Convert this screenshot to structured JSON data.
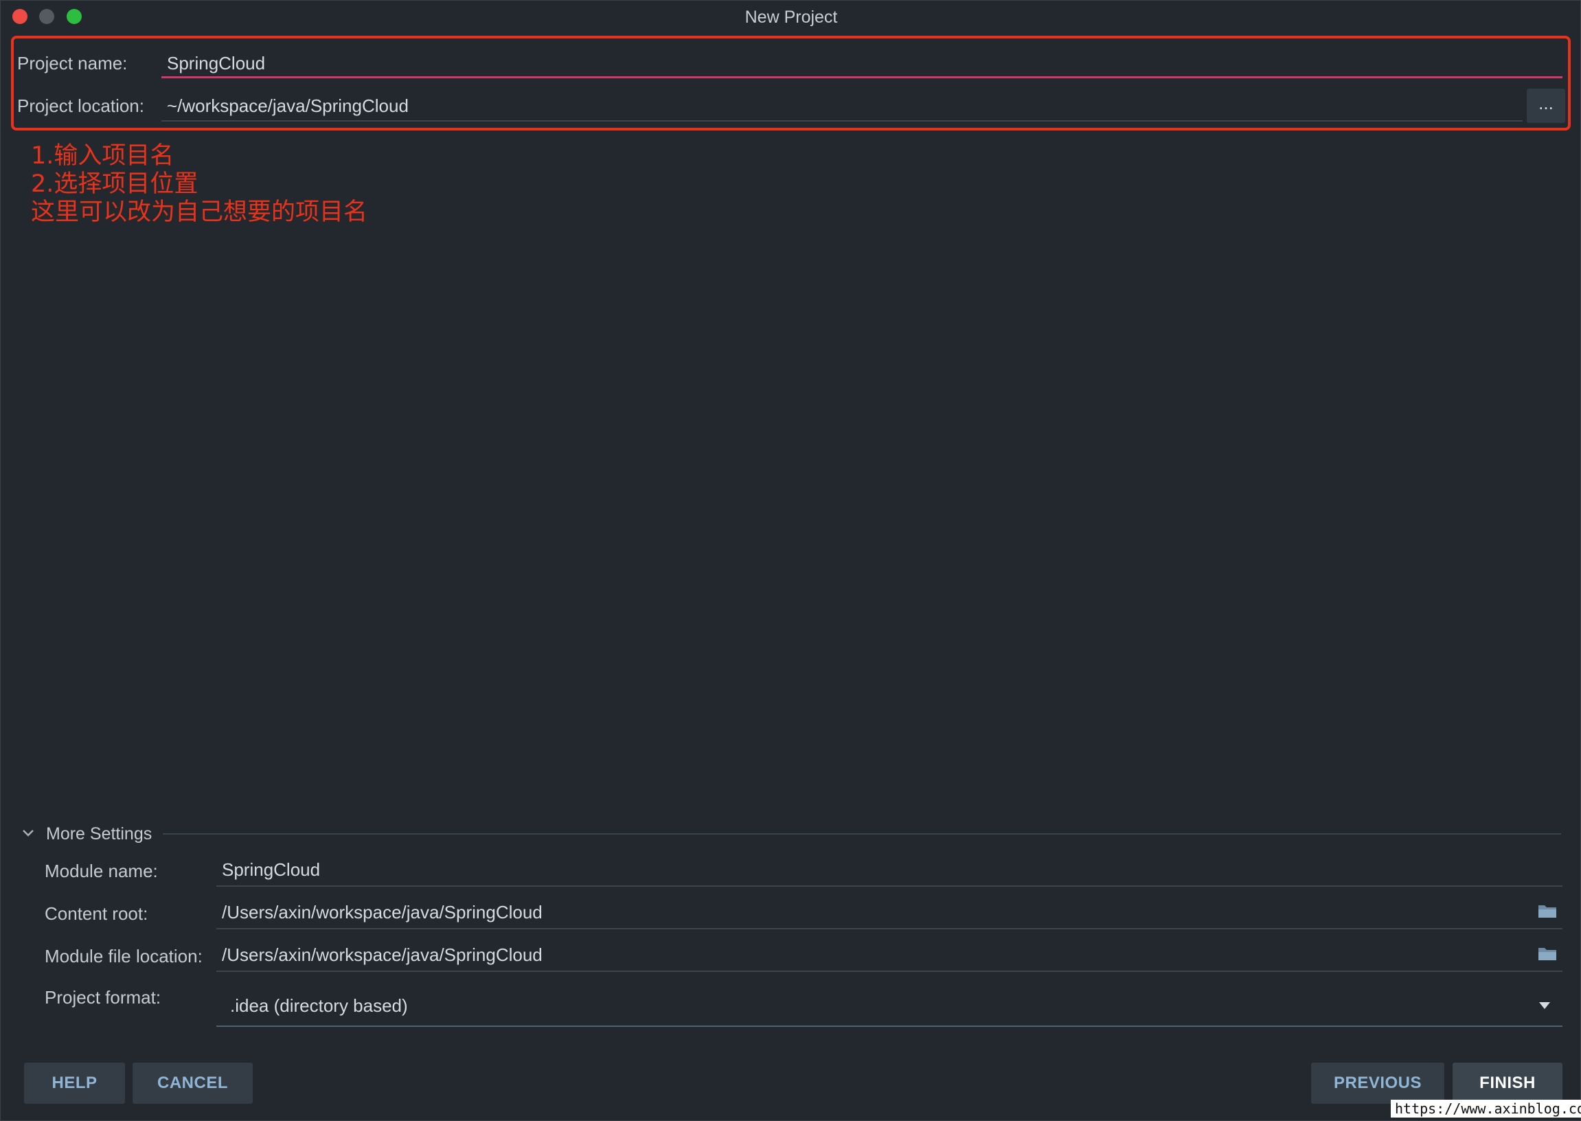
{
  "window": {
    "title": "New Project"
  },
  "project": {
    "name_label": "Project name:",
    "name_value": "SpringCloud",
    "location_label": "Project location:",
    "location_value": "~/workspace/java/SpringCloud",
    "browse_label": "..."
  },
  "annotation": {
    "line1": "1.输入项目名",
    "line2": "2.选择项目位置",
    "line3": "这里可以改为自己想要的项目名",
    "color": "#e8331c"
  },
  "more_settings": {
    "label": "More Settings",
    "expanded": true,
    "module_name_label": "Module name:",
    "module_name_value": "SpringCloud",
    "content_root_label": "Content root:",
    "content_root_value": "/Users/axin/workspace/java/SpringCloud",
    "module_file_label": "Module file location:",
    "module_file_value": "/Users/axin/workspace/java/SpringCloud",
    "project_format_label": "Project format:",
    "project_format_value": ".idea (directory based)"
  },
  "buttons": {
    "help": "HELP",
    "cancel": "CANCEL",
    "previous": "PREVIOUS",
    "finish": "FINISH"
  },
  "watermark": "https://www.axinblog.com",
  "colors": {
    "background": "#22282d",
    "focus_underline": "#d2386c",
    "button_text": "#8fb6d6",
    "annotation": "#e8331c"
  }
}
